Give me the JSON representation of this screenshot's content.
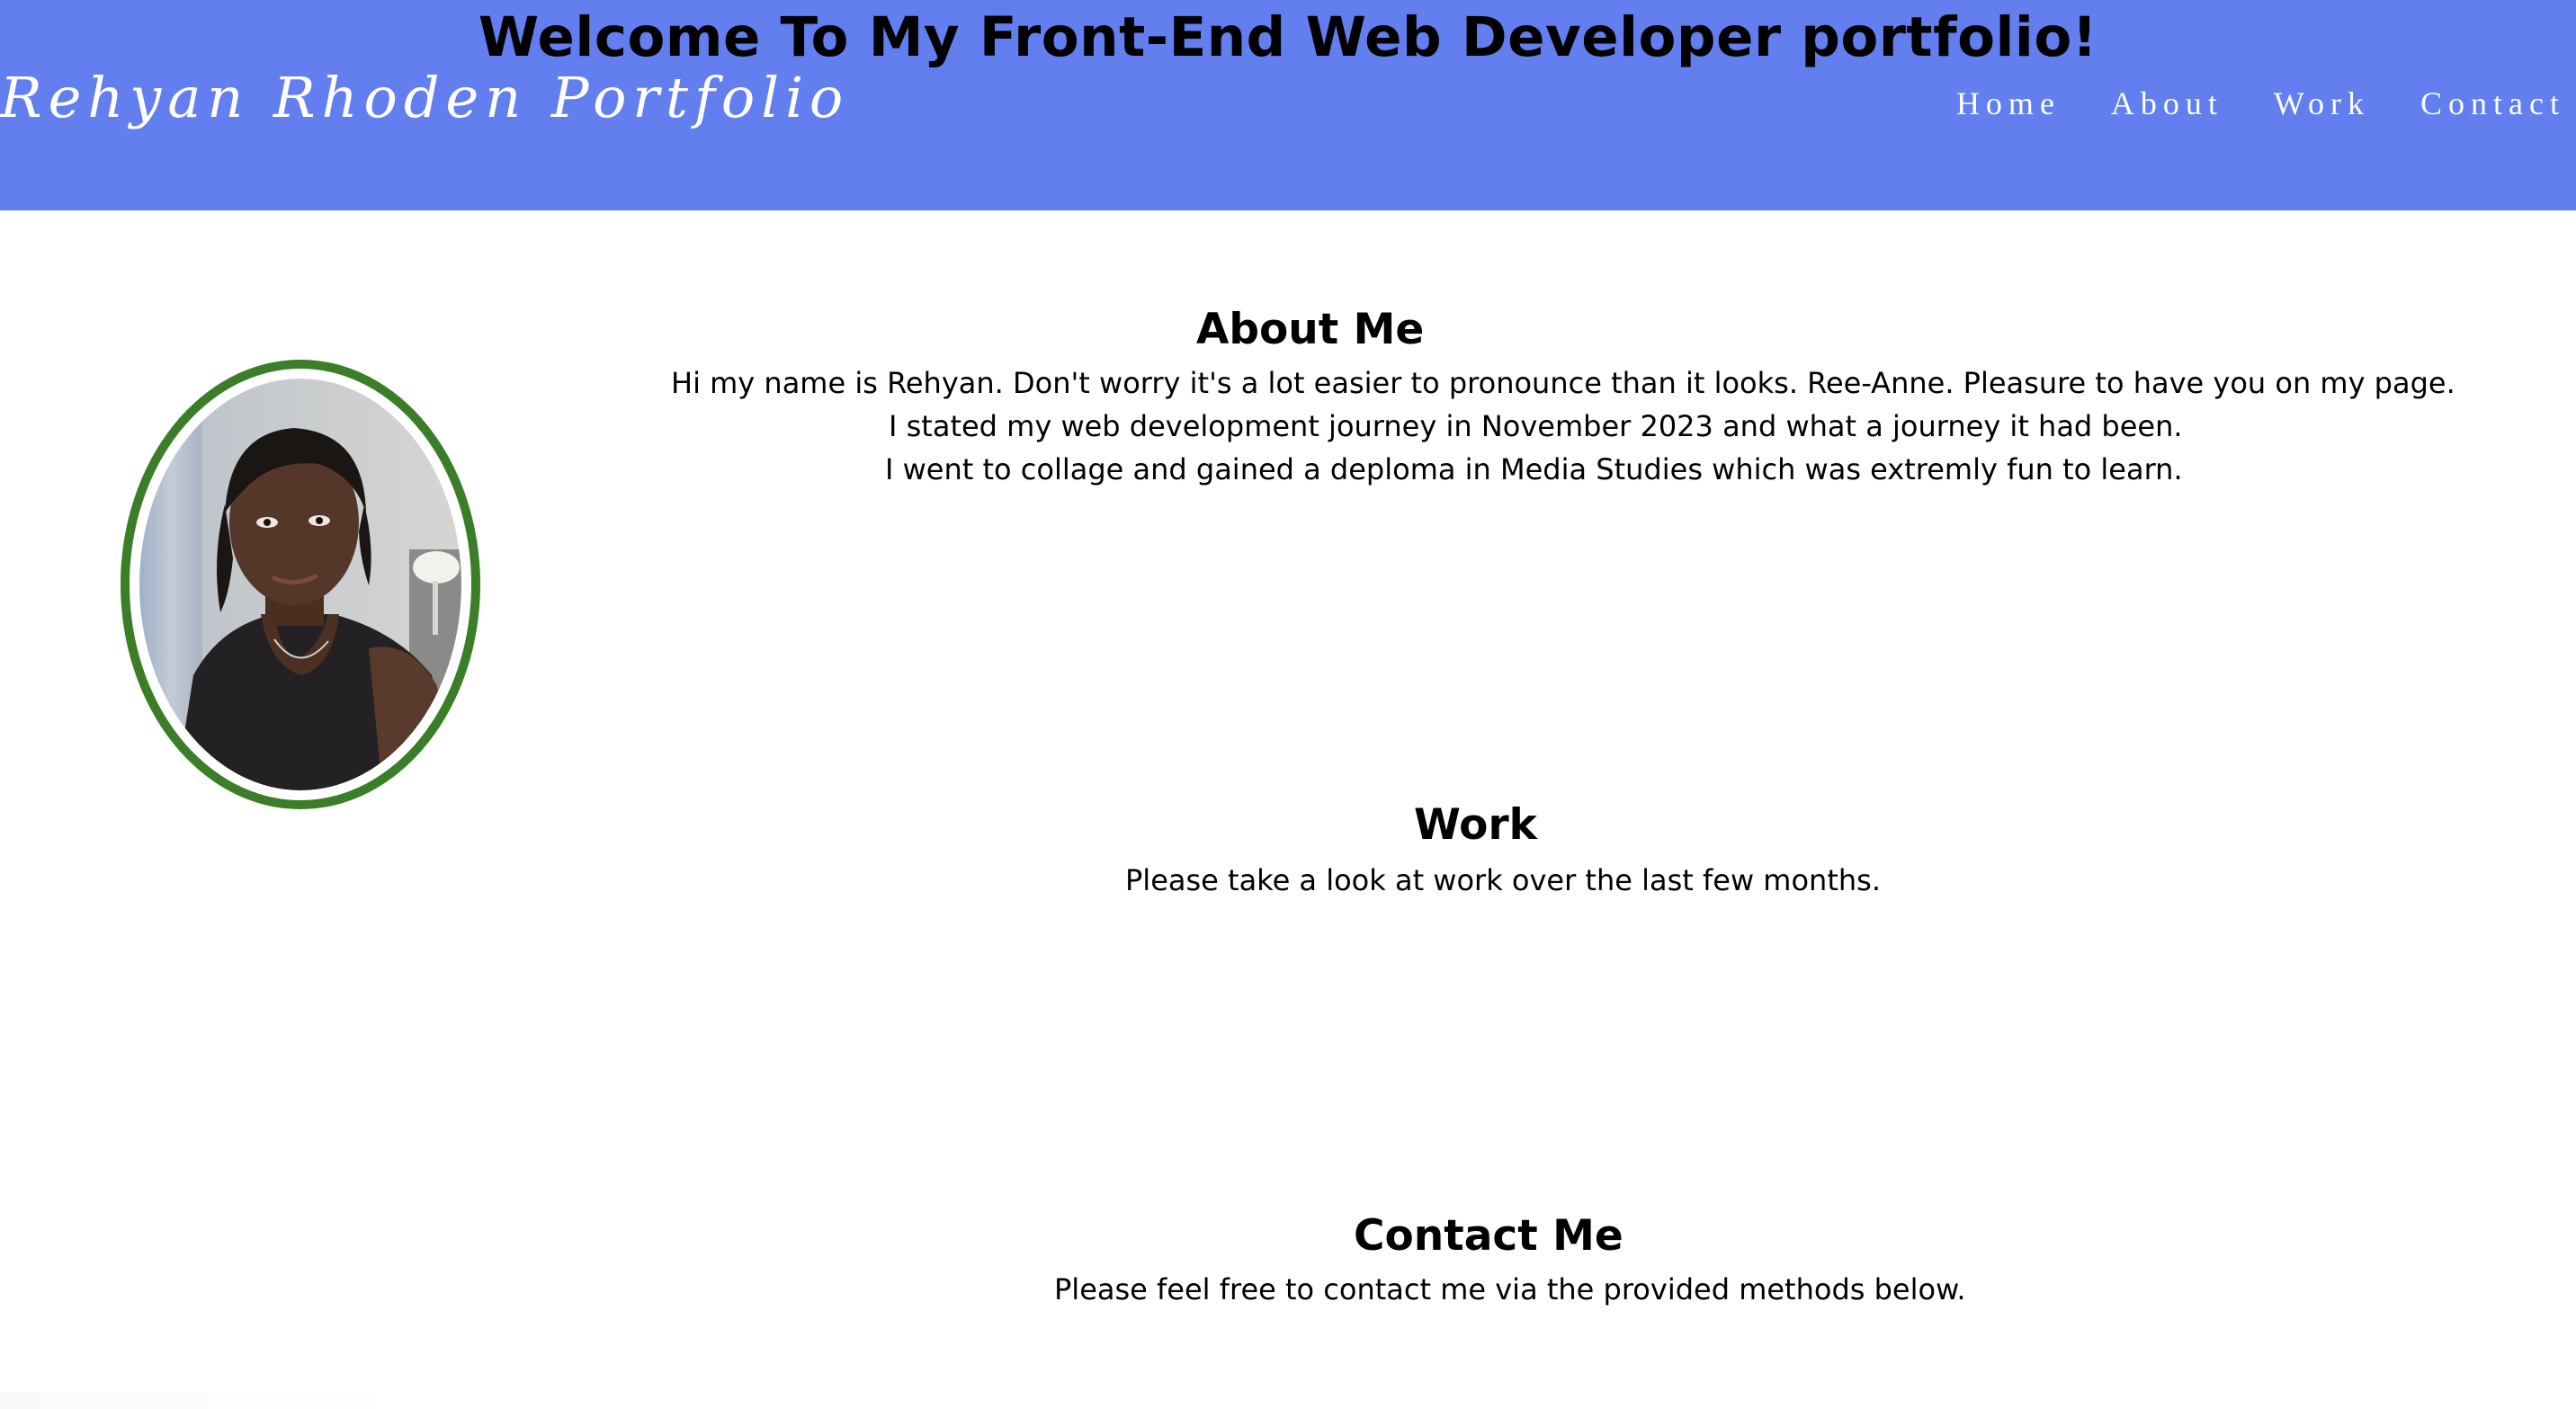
{
  "header": {
    "welcome_title": "Welcome To My Front-End Web Developer portfolio!",
    "brand_name": "Rehyan Rhoden Portfolio",
    "nav": [
      {
        "label": "Home"
      },
      {
        "label": "About"
      },
      {
        "label": "Work"
      },
      {
        "label": "Contact"
      }
    ],
    "background_color": "#627eef"
  },
  "profile": {
    "ring_color": "#3a7e28"
  },
  "about": {
    "heading": "About Me",
    "lines": [
      "Hi my name is Rehyan. Don't worry it's a lot easier to pronounce than it looks. Ree-Anne. Pleasure to have you on my page.",
      "I stated my web development journey in November 2023 and what a journey it had been.",
      "I went to collage and gained a deploma in Media Studies which was extremly fun to learn."
    ]
  },
  "work": {
    "heading": "Work",
    "description": "Please take a look at work over the last few months."
  },
  "contact": {
    "heading": "Contact Me",
    "description": "Please feel free to contact me via the provided methods below."
  }
}
